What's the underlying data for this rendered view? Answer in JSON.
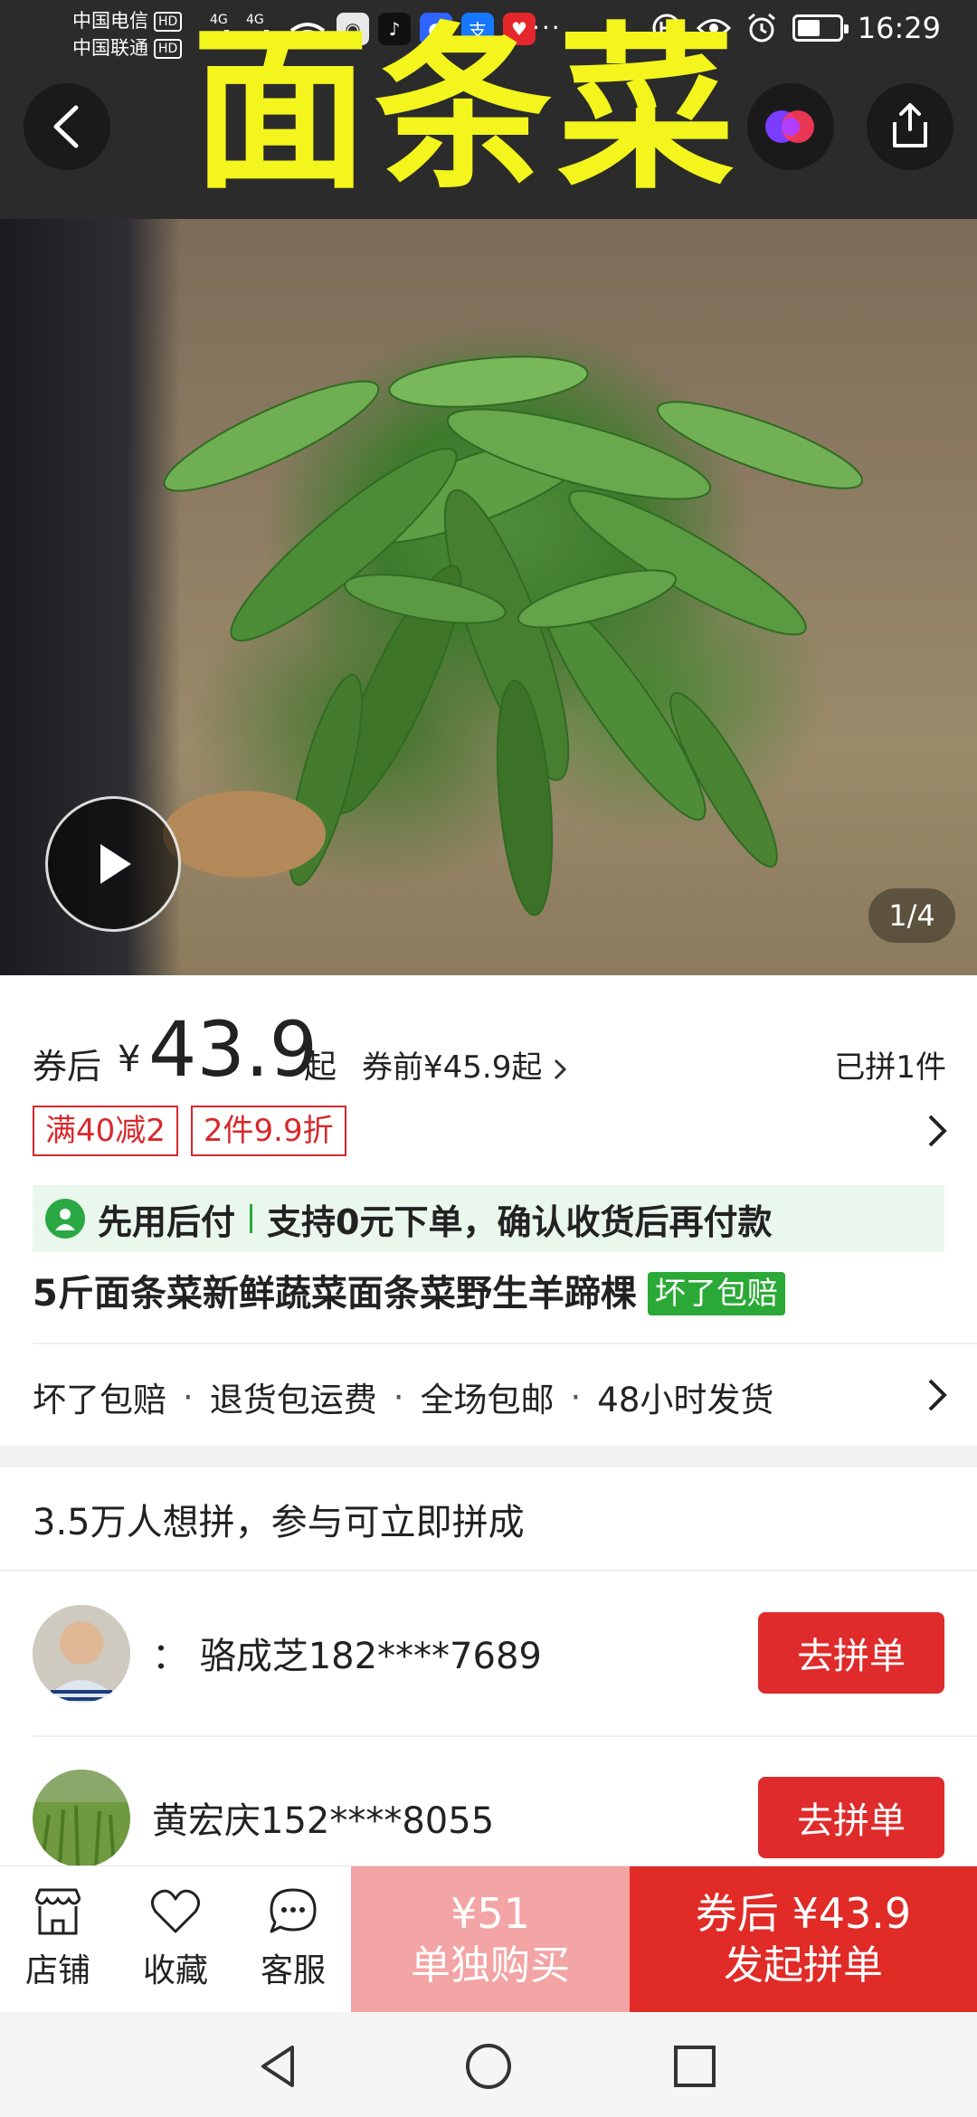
{
  "status_bar": {
    "carrier1": "中国电信",
    "carrier2": "中国联通",
    "hd": "HD",
    "net1": "4G",
    "net2": "4G",
    "more": "···",
    "time": "16:29"
  },
  "header": {
    "banner_title": "面条菜"
  },
  "hero": {
    "pager": "1/4"
  },
  "price": {
    "after_coupon_label": "券后",
    "currency": "¥",
    "value": "43.9",
    "from": "起",
    "before_coupon": "券前¥45.9起",
    "joined_count": "已拼1件"
  },
  "coupons": [
    "满40减2",
    "2件9.9折"
  ],
  "pay_later": {
    "title": "先用后付",
    "desc": "支持0元下单，确认收货后再付款"
  },
  "product": {
    "title": "5斤面条菜新鲜蔬菜面条菜野生羊蹄棵",
    "tag": "坏了包赔"
  },
  "guarantees": [
    "坏了包赔",
    "退货包运费",
    "全场包邮",
    "48小时发货"
  ],
  "guarantee_sep": "·",
  "group": {
    "heading": "3.5万人想拼，参与可立即拼成",
    "rows": [
      {
        "name": "：  骆成芝182****7689",
        "button": "去拼单"
      },
      {
        "name": "黄宏庆152****8055",
        "button": "去拼单"
      }
    ]
  },
  "bottom_bar": {
    "store": "店铺",
    "favorite": "收藏",
    "service": "客服",
    "single_price": "¥51",
    "single_label": "单独购买",
    "group_price": "券后 ¥43.9",
    "group_label": "发起拼单"
  },
  "colors": {
    "accent_red": "#e02b27",
    "light_red": "#f3a4a4",
    "banner_yellow": "#f3f51c",
    "pay_green": "#2aa843"
  }
}
